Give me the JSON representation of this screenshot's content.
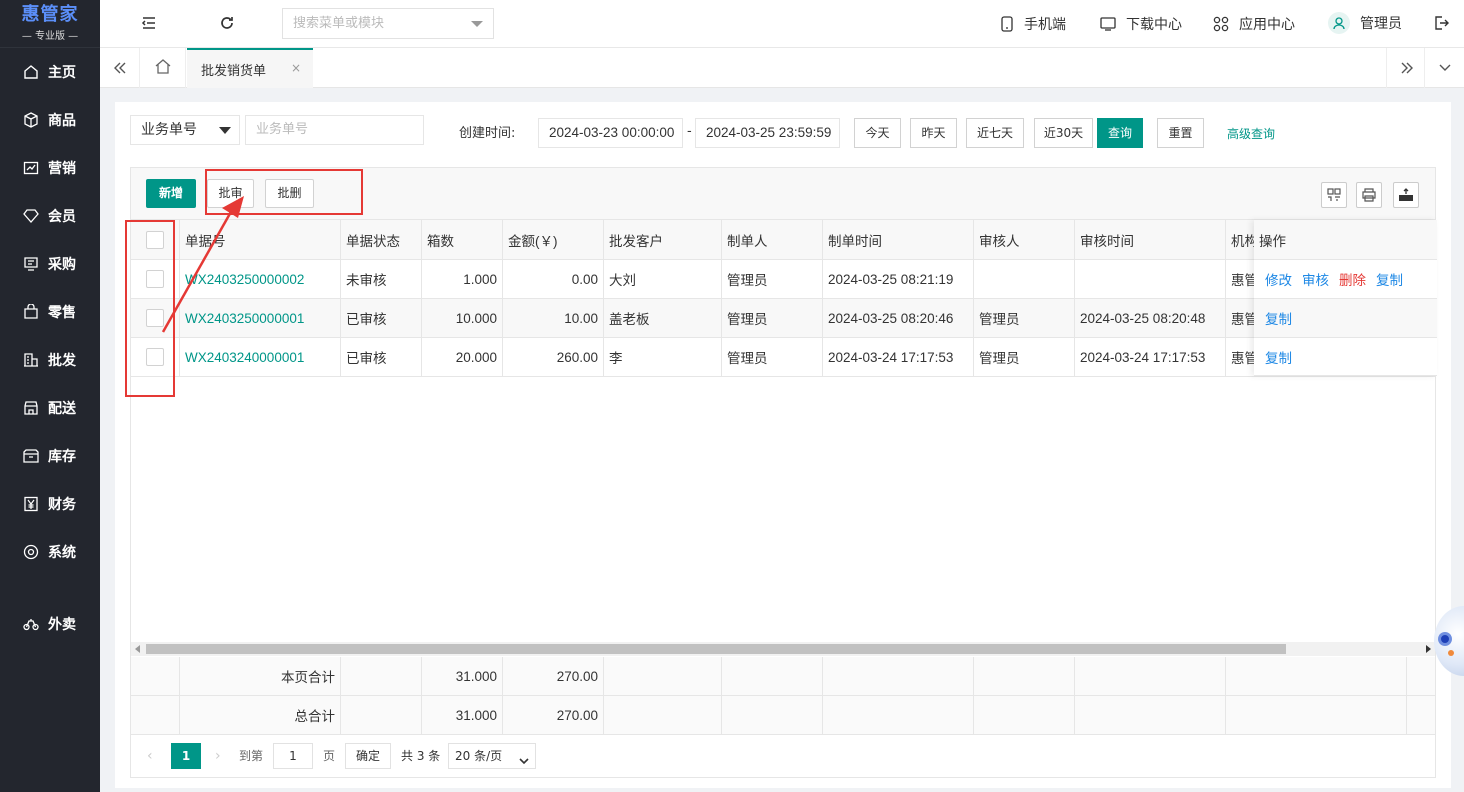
{
  "brand": {
    "title": "惠管家",
    "subtitle": "— 专业版 —"
  },
  "sidebar": {
    "items": [
      {
        "label": "主页",
        "icon": "home-icon"
      },
      {
        "label": "商品",
        "icon": "box-icon"
      },
      {
        "label": "营销",
        "icon": "chart-icon"
      },
      {
        "label": "会员",
        "icon": "diamond-icon"
      },
      {
        "label": "采购",
        "icon": "purchase-icon"
      },
      {
        "label": "零售",
        "icon": "bag-icon"
      },
      {
        "label": "批发",
        "icon": "building-icon"
      },
      {
        "label": "配送",
        "icon": "store-icon"
      },
      {
        "label": "库存",
        "icon": "inventory-icon"
      },
      {
        "label": "财务",
        "icon": "yen-icon"
      },
      {
        "label": "系统",
        "icon": "settings-icon"
      },
      {
        "label": "外卖",
        "icon": "bike-icon"
      }
    ]
  },
  "topbar": {
    "search_placeholder": "搜索菜单或模块",
    "mobile": "手机端",
    "download": "下载中心",
    "apps": "应用中心",
    "user": "管理员"
  },
  "tabs": {
    "active": "批发销货单",
    "close": "×"
  },
  "filter": {
    "field_select": "业务单号",
    "field_placeholder": "业务单号",
    "created_label": "创建时间:",
    "date_from": "2024-03-23 00:00:00",
    "date_sep": "-",
    "date_to": "2024-03-25 23:59:59",
    "today": "今天",
    "yesterday": "昨天",
    "last7": "近七天",
    "last30": "近30天",
    "query": "查询",
    "reset": "重置",
    "advanced": "高级查询"
  },
  "toolbar": {
    "add": "新增",
    "batch_audit": "批审",
    "batch_delete": "批删"
  },
  "table": {
    "headers": [
      "单据号",
      "单据状态",
      "箱数",
      "金额(￥)",
      "批发客户",
      "制单人",
      "制单时间",
      "审核人",
      "审核时间",
      "机构",
      "操作"
    ],
    "rows": [
      {
        "no": "WX2403250000002",
        "status": "未审核",
        "boxes": "1.000",
        "amount": "0.00",
        "customer": "大刘",
        "maker": "管理员",
        "made_at": "2024-03-25 08:21:19",
        "auditor": "",
        "audited_at": "",
        "org": "惠管",
        "ops": [
          "修改",
          "审核",
          "删除",
          "复制"
        ]
      },
      {
        "no": "WX2403250000001",
        "status": "已审核",
        "boxes": "10.000",
        "amount": "10.00",
        "customer": "盖老板",
        "maker": "管理员",
        "made_at": "2024-03-25 08:20:46",
        "auditor": "管理员",
        "audited_at": "2024-03-25 08:20:48",
        "org": "惠管",
        "ops": [
          "复制"
        ]
      },
      {
        "no": "WX2403240000001",
        "status": "已审核",
        "boxes": "20.000",
        "amount": "260.00",
        "customer": "李",
        "maker": "管理员",
        "made_at": "2024-03-24 17:17:53",
        "auditor": "管理员",
        "audited_at": "2024-03-24 17:17:53",
        "org": "惠管",
        "ops": [
          "复制"
        ]
      }
    ],
    "page_total_label": "本页合计",
    "page_total_boxes": "31.000",
    "page_total_amount": "270.00",
    "grand_total_label": "总合计",
    "grand_total_boxes": "31.000",
    "grand_total_amount": "270.00"
  },
  "pager": {
    "current": "1",
    "goto": "到第",
    "page_input": "1",
    "page_unit": "页",
    "confirm": "确定",
    "total": "共 3 条",
    "page_size": "20 条/页"
  }
}
